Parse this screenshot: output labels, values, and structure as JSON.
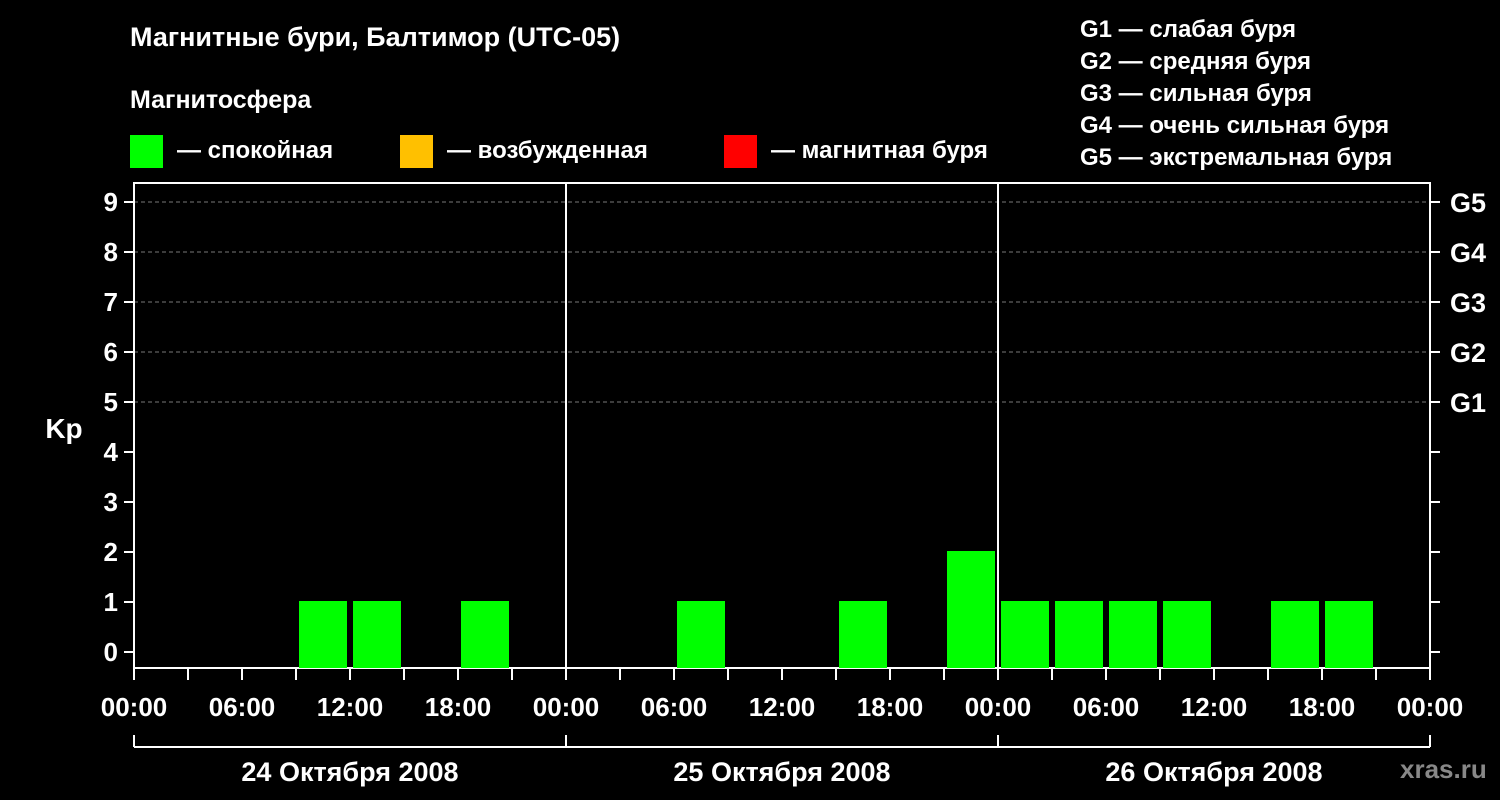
{
  "title": "Магнитные бури, Балтимор (UTC-05)",
  "legend": {
    "heading": "Магнитосфера",
    "items": [
      {
        "label": "— спокойная",
        "color": "#00ff00"
      },
      {
        "label": "— возбужденная",
        "color": "#ffc000"
      },
      {
        "label": "— магнитная буря",
        "color": "#ff0000"
      }
    ]
  },
  "g_scale": [
    "G1 — слабая буря",
    "G2 — средняя буря",
    "G3 — сильная буря",
    "G4 — очень сильная буря",
    "G5 — экстремальная буря"
  ],
  "watermark": "xras.ru",
  "chart_data": {
    "type": "bar",
    "ylabel": "Kp",
    "ylim": [
      0,
      9
    ],
    "y_ticks": [
      "0",
      "1",
      "2",
      "3",
      "4",
      "5",
      "6",
      "7",
      "8",
      "9"
    ],
    "right_ticks": [
      {
        "kp": 5,
        "label": "G1"
      },
      {
        "kp": 6,
        "label": "G2"
      },
      {
        "kp": 7,
        "label": "G3"
      },
      {
        "kp": 8,
        "label": "G4"
      },
      {
        "kp": 9,
        "label": "G5"
      }
    ],
    "x_ticks": [
      "00:00",
      "06:00",
      "12:00",
      "18:00",
      "00:00",
      "06:00",
      "12:00",
      "18:00",
      "00:00",
      "06:00",
      "12:00",
      "18:00",
      "00:00"
    ],
    "days": [
      "24 Октября 2008",
      "25 Октября 2008",
      "26 Октября 2008"
    ],
    "interval_hours": 3,
    "values": [
      0,
      0,
      0,
      1,
      1,
      0,
      1,
      0,
      0,
      0,
      1,
      0,
      0,
      1,
      0,
      2,
      1,
      1,
      1,
      1,
      0,
      1,
      1,
      0
    ],
    "grid": "dashed at Kp 5–9",
    "bar_color": "#00ff00"
  }
}
